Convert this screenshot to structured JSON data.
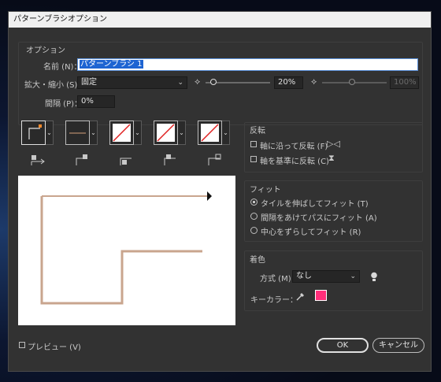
{
  "window": {
    "title": "パターンブラシオプション"
  },
  "options": {
    "section_label": "オプション",
    "name_label": "名前 (N)：",
    "name_value": "パターンブラシ 1",
    "scale_label": "拡大・縮小 (S)：",
    "scale_mode": "固定",
    "scale_min": "20%",
    "scale_max": "100%",
    "spacing_label": "間隔 (P)：",
    "spacing_value": "0%"
  },
  "flip": {
    "section_label": "反転",
    "along_label": "軸に沿って反転 (F)",
    "across_label": "軸を基準に反転 (C)"
  },
  "fit": {
    "section_label": "フィット",
    "options": [
      "タイルを伸ばしてフィット (T)",
      "間隔をあけてパスにフィット (A)",
      "中心をずらしてフィット (R)"
    ],
    "selected": 0
  },
  "colorize": {
    "section_label": "着色",
    "method_label": "方式 (M)：",
    "method_value": "なし",
    "key_color_label": "キーカラー：",
    "key_color": "#ff2e7a"
  },
  "footer": {
    "preview_label": "プレビュー (V)",
    "ok_label": "OK",
    "cancel_label": "キャンセル"
  },
  "icons": [
    "tile-side-icon",
    "tile-outer-corner-icon",
    "tile-inner-corner-icon",
    "tile-start-icon",
    "tile-end-icon",
    "chevron-down-icon",
    "lightbulb-icon",
    "eyedropper-icon",
    "flip-along-icon",
    "flip-across-icon"
  ]
}
